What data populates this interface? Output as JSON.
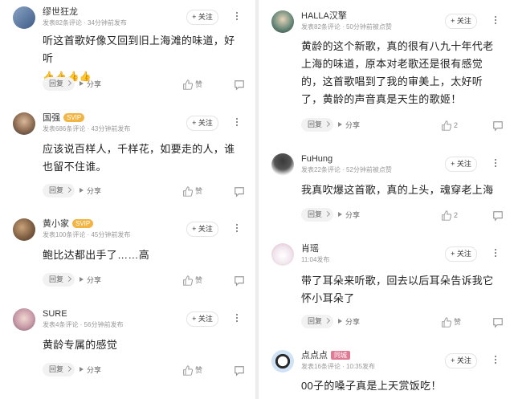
{
  "left": [
    {
      "username": "缪世狂龙",
      "badge": "",
      "meta": "发表82条评论 · 34分钟前发布",
      "text": "听这首歌好像又回到旧上海滩的味道，好听",
      "emoji": "👍👍👍👍",
      "likes": "赞"
    },
    {
      "username": "国强",
      "badge": "SVIP",
      "meta": "发表686条评论 · 43分钟前发布",
      "text": "应该说百样人，千样花，如要走的人，谁也留不住谁。",
      "likes": "赞"
    },
    {
      "username": "黄小家",
      "badge": "SVIP",
      "meta": "发表100条评论 · 45分钟前发布",
      "text": "鲍比达都出手了……高",
      "likes": "赞"
    },
    {
      "username": "SURE",
      "badge": "",
      "meta": "发表4条评论 · 56分钟前发布",
      "text": "黄龄专属的感觉",
      "likes": "赞"
    }
  ],
  "right": [
    {
      "username": "HALLA汉擎",
      "badge": "",
      "meta": "发表82条评论 · 50分钟前被点赞",
      "text": "黄龄的这个新歌，真的很有八九十年代老上海的味道，原本对老歌还是很有感觉的，这首歌唱到了我的审美上，太好听了，黄龄的声音真是天生的歌姬！",
      "likes": "2"
    },
    {
      "username": "FuHung",
      "badge": "",
      "meta": "发表22条评论 · 52分钟前被点赞",
      "text": "我真吹爆这首歌，真的上头，魂穿老上海",
      "likes": "2"
    },
    {
      "username": "肖瑶",
      "badge": "",
      "meta": "11:04发布",
      "text": "带了耳朵来听歌，回去以后耳朵告诉我它怀小耳朵了",
      "likes": "赞"
    },
    {
      "username": "点点点",
      "badge": "同城",
      "meta": "发表16条评论 · 10:35发布",
      "text": "00子的嗓子真是上天赏饭吃！",
      "likes": ""
    }
  ],
  "labels": {
    "follow": "+ 关注",
    "reply": "回复",
    "share": "分享"
  },
  "colors": {
    "svip_badge": "#f2b544",
    "tag_badge": "#e07b95",
    "card": "#ffffff",
    "gap": "#ececec"
  }
}
